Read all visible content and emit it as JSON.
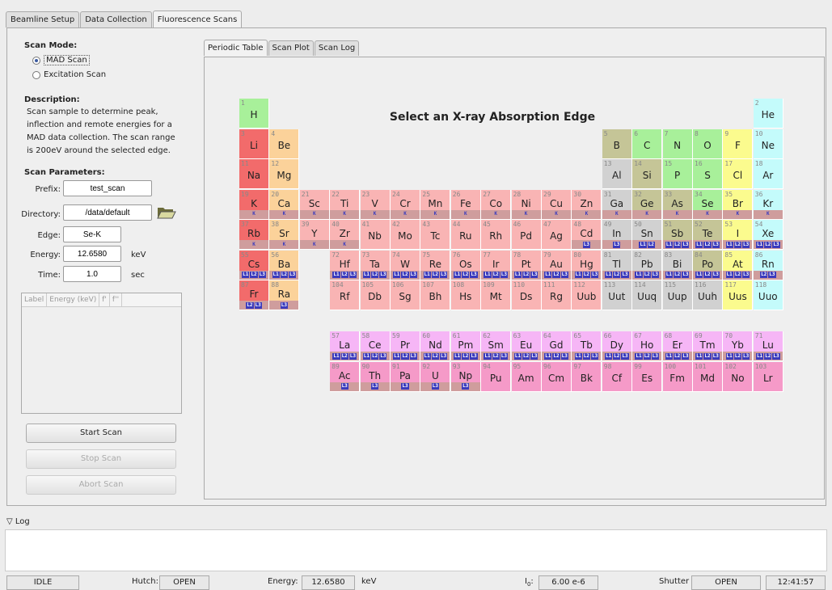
{
  "tabs": [
    "Beamline Setup",
    "Data Collection",
    "Fluorescence Scans"
  ],
  "active_tab": "Fluorescence Scans",
  "left": {
    "scan_mode_label": "Scan Mode:",
    "mode_mad": "MAD Scan",
    "mode_excitation": "Excitation Scan",
    "description_label": "Description:",
    "description": "Scan sample to determine peak, inflection and remote energies for a MAD data collection. The scan range is 200eV around the selected edge.",
    "params_label": "Scan Parameters:",
    "prefix_label": "Prefix:",
    "prefix": "test_scan",
    "directory_label": "Directory:",
    "directory": "/data/default",
    "edge_label": "Edge:",
    "edge": "Se-K",
    "energy_label": "Energy:",
    "energy": "12.6580",
    "energy_unit": "keV",
    "time_label": "Time:",
    "time": "1.0",
    "time_unit": "sec",
    "table_cols": [
      "Label",
      "Energy (keV)",
      "f'",
      "f''"
    ],
    "start_button": "Start Scan",
    "stop_button": "Stop Scan",
    "abort_button": "Abort Scan"
  },
  "subtabs": [
    "Periodic Table",
    "Scan Plot",
    "Scan Log"
  ],
  "active_subtab": "Periodic Table",
  "periodic": {
    "title": "Select an X-ray Absorption Edge",
    "colors": {
      "alkali": "#f26b6b",
      "alkaline": "#fbd29a",
      "transition": "#f9b4b4",
      "post": "#d1d1d1",
      "metalloid": "#c5c597",
      "nonmetal": "#a8f09a",
      "halogen": "#fbfb8e",
      "noble": "#c4fbfb",
      "lanthanide": "#f6b6f6",
      "actinide": "#f59ac8",
      "edge_band": "#cf9d9d"
    },
    "elements": [
      {
        "z": "1",
        "s": "H",
        "c": "nonmetal",
        "r": 1,
        "g": 1
      },
      {
        "z": "2",
        "s": "He",
        "c": "noble",
        "r": 1,
        "g": 18
      },
      {
        "z": "3",
        "s": "Li",
        "c": "alkali",
        "r": 2,
        "g": 1
      },
      {
        "z": "4",
        "s": "Be",
        "c": "alkaline",
        "r": 2,
        "g": 2
      },
      {
        "z": "5",
        "s": "B",
        "c": "metalloid",
        "r": 2,
        "g": 13
      },
      {
        "z": "6",
        "s": "C",
        "c": "nonmetal",
        "r": 2,
        "g": 14
      },
      {
        "z": "7",
        "s": "N",
        "c": "nonmetal",
        "r": 2,
        "g": 15
      },
      {
        "z": "8",
        "s": "O",
        "c": "nonmetal",
        "r": 2,
        "g": 16
      },
      {
        "z": "9",
        "s": "F",
        "c": "halogen",
        "r": 2,
        "g": 17
      },
      {
        "z": "10",
        "s": "Ne",
        "c": "noble",
        "r": 2,
        "g": 18
      },
      {
        "z": "11",
        "s": "Na",
        "c": "alkali",
        "r": 3,
        "g": 1
      },
      {
        "z": "12",
        "s": "Mg",
        "c": "alkaline",
        "r": 3,
        "g": 2
      },
      {
        "z": "13",
        "s": "Al",
        "c": "post",
        "r": 3,
        "g": 13
      },
      {
        "z": "14",
        "s": "Si",
        "c": "metalloid",
        "r": 3,
        "g": 14
      },
      {
        "z": "15",
        "s": "P",
        "c": "nonmetal",
        "r": 3,
        "g": 15
      },
      {
        "z": "16",
        "s": "S",
        "c": "nonmetal",
        "r": 3,
        "g": 16
      },
      {
        "z": "17",
        "s": "Cl",
        "c": "halogen",
        "r": 3,
        "g": 17
      },
      {
        "z": "18",
        "s": "Ar",
        "c": "noble",
        "r": 3,
        "g": 18
      },
      {
        "z": "19",
        "s": "K",
        "c": "alkali",
        "r": 4,
        "g": 1,
        "e": [
          "K"
        ]
      },
      {
        "z": "20",
        "s": "Ca",
        "c": "alkaline",
        "r": 4,
        "g": 2,
        "e": [
          "K"
        ]
      },
      {
        "z": "21",
        "s": "Sc",
        "c": "transition",
        "r": 4,
        "g": 3,
        "e": [
          "K"
        ]
      },
      {
        "z": "22",
        "s": "Ti",
        "c": "transition",
        "r": 4,
        "g": 4,
        "e": [
          "K"
        ]
      },
      {
        "z": "23",
        "s": "V",
        "c": "transition",
        "r": 4,
        "g": 5,
        "e": [
          "K"
        ]
      },
      {
        "z": "24",
        "s": "Cr",
        "c": "transition",
        "r": 4,
        "g": 6,
        "e": [
          "K"
        ]
      },
      {
        "z": "25",
        "s": "Mn",
        "c": "transition",
        "r": 4,
        "g": 7,
        "e": [
          "K"
        ]
      },
      {
        "z": "26",
        "s": "Fe",
        "c": "transition",
        "r": 4,
        "g": 8,
        "e": [
          "K"
        ]
      },
      {
        "z": "27",
        "s": "Co",
        "c": "transition",
        "r": 4,
        "g": 9,
        "e": [
          "K"
        ]
      },
      {
        "z": "28",
        "s": "Ni",
        "c": "transition",
        "r": 4,
        "g": 10,
        "e": [
          "K"
        ]
      },
      {
        "z": "29",
        "s": "Cu",
        "c": "transition",
        "r": 4,
        "g": 11,
        "e": [
          "K"
        ]
      },
      {
        "z": "30",
        "s": "Zn",
        "c": "transition",
        "r": 4,
        "g": 12,
        "e": [
          "K"
        ]
      },
      {
        "z": "31",
        "s": "Ga",
        "c": "post",
        "r": 4,
        "g": 13,
        "e": [
          "K"
        ]
      },
      {
        "z": "32",
        "s": "Ge",
        "c": "metalloid",
        "r": 4,
        "g": 14,
        "e": [
          "K"
        ]
      },
      {
        "z": "33",
        "s": "As",
        "c": "metalloid",
        "r": 4,
        "g": 15,
        "e": [
          "K"
        ]
      },
      {
        "z": "34",
        "s": "Se",
        "c": "nonmetal",
        "r": 4,
        "g": 16,
        "e": [
          "K"
        ]
      },
      {
        "z": "35",
        "s": "Br",
        "c": "halogen",
        "r": 4,
        "g": 17,
        "e": [
          "K"
        ]
      },
      {
        "z": "36",
        "s": "Kr",
        "c": "noble",
        "r": 4,
        "g": 18,
        "e": [
          "K"
        ]
      },
      {
        "z": "37",
        "s": "Rb",
        "c": "alkali",
        "r": 5,
        "g": 1,
        "e": [
          "K"
        ]
      },
      {
        "z": "38",
        "s": "Sr",
        "c": "alkaline",
        "r": 5,
        "g": 2,
        "e": [
          "K"
        ]
      },
      {
        "z": "39",
        "s": "Y",
        "c": "transition",
        "r": 5,
        "g": 3,
        "e": [
          "K"
        ]
      },
      {
        "z": "40",
        "s": "Zr",
        "c": "transition",
        "r": 5,
        "g": 4,
        "e": [
          "K"
        ]
      },
      {
        "z": "41",
        "s": "Nb",
        "c": "transition",
        "r": 5,
        "g": 5
      },
      {
        "z": "42",
        "s": "Mo",
        "c": "transition",
        "r": 5,
        "g": 6
      },
      {
        "z": "43",
        "s": "Tc",
        "c": "transition",
        "r": 5,
        "g": 7
      },
      {
        "z": "44",
        "s": "Ru",
        "c": "transition",
        "r": 5,
        "g": 8
      },
      {
        "z": "45",
        "s": "Rh",
        "c": "transition",
        "r": 5,
        "g": 9
      },
      {
        "z": "46",
        "s": "Pd",
        "c": "transition",
        "r": 5,
        "g": 10
      },
      {
        "z": "47",
        "s": "Ag",
        "c": "transition",
        "r": 5,
        "g": 11
      },
      {
        "z": "48",
        "s": "Cd",
        "c": "transition",
        "r": 5,
        "g": 12,
        "e": [
          "L3"
        ]
      },
      {
        "z": "49",
        "s": "In",
        "c": "post",
        "r": 5,
        "g": 13,
        "e": [
          "L3"
        ]
      },
      {
        "z": "50",
        "s": "Sn",
        "c": "post",
        "r": 5,
        "g": 14,
        "e": [
          "L1",
          "L2"
        ]
      },
      {
        "z": "51",
        "s": "Sb",
        "c": "metalloid",
        "r": 5,
        "g": 15,
        "e": [
          "L1",
          "L2",
          "L3"
        ]
      },
      {
        "z": "52",
        "s": "Te",
        "c": "metalloid",
        "r": 5,
        "g": 16,
        "e": [
          "L1",
          "L2",
          "L3"
        ]
      },
      {
        "z": "53",
        "s": "I",
        "c": "halogen",
        "r": 5,
        "g": 17,
        "e": [
          "L1",
          "L2",
          "L3"
        ]
      },
      {
        "z": "54",
        "s": "Xe",
        "c": "noble",
        "r": 5,
        "g": 18,
        "e": [
          "L1",
          "L2",
          "L3"
        ]
      },
      {
        "z": "55",
        "s": "Cs",
        "c": "alkali",
        "r": 6,
        "g": 1,
        "e": [
          "L1",
          "L2",
          "L3"
        ]
      },
      {
        "z": "56",
        "s": "Ba",
        "c": "alkaline",
        "r": 6,
        "g": 2,
        "e": [
          "L1",
          "L2",
          "L3"
        ]
      },
      {
        "z": "72",
        "s": "Hf",
        "c": "transition",
        "r": 6,
        "g": 4,
        "e": [
          "L1",
          "L2",
          "L3"
        ]
      },
      {
        "z": "73",
        "s": "Ta",
        "c": "transition",
        "r": 6,
        "g": 5,
        "e": [
          "L1",
          "L2",
          "L3"
        ]
      },
      {
        "z": "74",
        "s": "W",
        "c": "transition",
        "r": 6,
        "g": 6,
        "e": [
          "L1",
          "L2",
          "L3"
        ]
      },
      {
        "z": "75",
        "s": "Re",
        "c": "transition",
        "r": 6,
        "g": 7,
        "e": [
          "L1",
          "L2",
          "L3"
        ]
      },
      {
        "z": "76",
        "s": "Os",
        "c": "transition",
        "r": 6,
        "g": 8,
        "e": [
          "L1",
          "L2",
          "L3"
        ]
      },
      {
        "z": "77",
        "s": "Ir",
        "c": "transition",
        "r": 6,
        "g": 9,
        "e": [
          "L1",
          "L2",
          "L3"
        ]
      },
      {
        "z": "78",
        "s": "Pt",
        "c": "transition",
        "r": 6,
        "g": 10,
        "e": [
          "L1",
          "L2",
          "L3"
        ]
      },
      {
        "z": "79",
        "s": "Au",
        "c": "transition",
        "r": 6,
        "g": 11,
        "e": [
          "L1",
          "L2",
          "L3"
        ]
      },
      {
        "z": "80",
        "s": "Hg",
        "c": "transition",
        "r": 6,
        "g": 12,
        "e": [
          "L1",
          "L2",
          "L3"
        ]
      },
      {
        "z": "81",
        "s": "Tl",
        "c": "post",
        "r": 6,
        "g": 13,
        "e": [
          "L1",
          "L2",
          "L3"
        ]
      },
      {
        "z": "82",
        "s": "Pb",
        "c": "post",
        "r": 6,
        "g": 14,
        "e": [
          "L1",
          "L2",
          "L3"
        ]
      },
      {
        "z": "83",
        "s": "Bi",
        "c": "post",
        "r": 6,
        "g": 15,
        "e": [
          "L1",
          "L2",
          "L3"
        ]
      },
      {
        "z": "84",
        "s": "Po",
        "c": "metalloid",
        "r": 6,
        "g": 16,
        "e": [
          "L1",
          "L2",
          "L3"
        ]
      },
      {
        "z": "85",
        "s": "At",
        "c": "halogen",
        "r": 6,
        "g": 17,
        "e": [
          "L1",
          "L2",
          "L3"
        ]
      },
      {
        "z": "86",
        "s": "Rn",
        "c": "noble",
        "r": 6,
        "g": 18,
        "e": [
          "L2",
          "L3"
        ]
      },
      {
        "z": "87",
        "s": "Fr",
        "c": "alkali",
        "r": 7,
        "g": 1,
        "e": [
          "L2",
          "L3"
        ]
      },
      {
        "z": "88",
        "s": "Ra",
        "c": "alkaline",
        "r": 7,
        "g": 2,
        "e": [
          "L3"
        ]
      },
      {
        "z": "104",
        "s": "Rf",
        "c": "transition",
        "r": 7,
        "g": 4
      },
      {
        "z": "105",
        "s": "Db",
        "c": "transition",
        "r": 7,
        "g": 5
      },
      {
        "z": "106",
        "s": "Sg",
        "c": "transition",
        "r": 7,
        "g": 6
      },
      {
        "z": "107",
        "s": "Bh",
        "c": "transition",
        "r": 7,
        "g": 7
      },
      {
        "z": "108",
        "s": "Hs",
        "c": "transition",
        "r": 7,
        "g": 8
      },
      {
        "z": "109",
        "s": "Mt",
        "c": "transition",
        "r": 7,
        "g": 9
      },
      {
        "z": "110",
        "s": "Ds",
        "c": "transition",
        "r": 7,
        "g": 10
      },
      {
        "z": "111",
        "s": "Rg",
        "c": "transition",
        "r": 7,
        "g": 11
      },
      {
        "z": "112",
        "s": "Uub",
        "c": "transition",
        "r": 7,
        "g": 12
      },
      {
        "z": "113",
        "s": "Uut",
        "c": "post",
        "r": 7,
        "g": 13
      },
      {
        "z": "114",
        "s": "Uuq",
        "c": "post",
        "r": 7,
        "g": 14
      },
      {
        "z": "115",
        "s": "Uup",
        "c": "post",
        "r": 7,
        "g": 15
      },
      {
        "z": "116",
        "s": "Uuh",
        "c": "post",
        "r": 7,
        "g": 16
      },
      {
        "z": "117",
        "s": "Uus",
        "c": "halogen",
        "r": 7,
        "g": 17
      },
      {
        "z": "118",
        "s": "Uuo",
        "c": "noble",
        "r": 7,
        "g": 18
      },
      {
        "z": "57",
        "s": "La",
        "c": "lanthanide",
        "r": 9,
        "g": 4,
        "e": [
          "L1",
          "L2",
          "L3"
        ]
      },
      {
        "z": "58",
        "s": "Ce",
        "c": "lanthanide",
        "r": 9,
        "g": 5,
        "e": [
          "L1",
          "L2",
          "L3"
        ]
      },
      {
        "z": "59",
        "s": "Pr",
        "c": "lanthanide",
        "r": 9,
        "g": 6,
        "e": [
          "L1",
          "L2",
          "L3"
        ]
      },
      {
        "z": "60",
        "s": "Nd",
        "c": "lanthanide",
        "r": 9,
        "g": 7,
        "e": [
          "L1",
          "L2",
          "L3"
        ]
      },
      {
        "z": "61",
        "s": "Pm",
        "c": "lanthanide",
        "r": 9,
        "g": 8,
        "e": [
          "L1",
          "L2",
          "L3"
        ]
      },
      {
        "z": "62",
        "s": "Sm",
        "c": "lanthanide",
        "r": 9,
        "g": 9,
        "e": [
          "L1",
          "L2",
          "L3"
        ]
      },
      {
        "z": "63",
        "s": "Eu",
        "c": "lanthanide",
        "r": 9,
        "g": 10,
        "e": [
          "L1",
          "L2",
          "L3"
        ]
      },
      {
        "z": "64",
        "s": "Gd",
        "c": "lanthanide",
        "r": 9,
        "g": 11,
        "e": [
          "L1",
          "L2",
          "L3"
        ]
      },
      {
        "z": "65",
        "s": "Tb",
        "c": "lanthanide",
        "r": 9,
        "g": 12,
        "e": [
          "L1",
          "L2",
          "L3"
        ]
      },
      {
        "z": "66",
        "s": "Dy",
        "c": "lanthanide",
        "r": 9,
        "g": 13,
        "e": [
          "L1",
          "L2",
          "L3"
        ]
      },
      {
        "z": "67",
        "s": "Ho",
        "c": "lanthanide",
        "r": 9,
        "g": 14,
        "e": [
          "L1",
          "L2",
          "L3"
        ]
      },
      {
        "z": "68",
        "s": "Er",
        "c": "lanthanide",
        "r": 9,
        "g": 15,
        "e": [
          "L1",
          "L2",
          "L3"
        ]
      },
      {
        "z": "69",
        "s": "Tm",
        "c": "lanthanide",
        "r": 9,
        "g": 16,
        "e": [
          "L1",
          "L2",
          "L3"
        ]
      },
      {
        "z": "70",
        "s": "Yb",
        "c": "lanthanide",
        "r": 9,
        "g": 17,
        "e": [
          "L1",
          "L2",
          "L3"
        ]
      },
      {
        "z": "71",
        "s": "Lu",
        "c": "lanthanide",
        "r": 9,
        "g": 18,
        "e": [
          "L1",
          "L2",
          "L3"
        ]
      },
      {
        "z": "89",
        "s": "Ac",
        "c": "actinide",
        "r": 10,
        "g": 4,
        "e": [
          "L3"
        ]
      },
      {
        "z": "90",
        "s": "Th",
        "c": "actinide",
        "r": 10,
        "g": 5,
        "e": [
          "L3"
        ]
      },
      {
        "z": "91",
        "s": "Pa",
        "c": "actinide",
        "r": 10,
        "g": 6,
        "e": [
          "L3"
        ]
      },
      {
        "z": "92",
        "s": "U",
        "c": "actinide",
        "r": 10,
        "g": 7,
        "e": [
          "L3"
        ]
      },
      {
        "z": "93",
        "s": "Np",
        "c": "actinide",
        "r": 10,
        "g": 8,
        "e": [
          "L3"
        ]
      },
      {
        "z": "94",
        "s": "Pu",
        "c": "actinide",
        "r": 10,
        "g": 9
      },
      {
        "z": "95",
        "s": "Am",
        "c": "actinide",
        "r": 10,
        "g": 10
      },
      {
        "z": "96",
        "s": "Cm",
        "c": "actinide",
        "r": 10,
        "g": 11
      },
      {
        "z": "97",
        "s": "Bk",
        "c": "actinide",
        "r": 10,
        "g": 12
      },
      {
        "z": "98",
        "s": "Cf",
        "c": "actinide",
        "r": 10,
        "g": 13
      },
      {
        "z": "99",
        "s": "Es",
        "c": "actinide",
        "r": 10,
        "g": 14
      },
      {
        "z": "100",
        "s": "Fm",
        "c": "actinide",
        "r": 10,
        "g": 15
      },
      {
        "z": "101",
        "s": "Md",
        "c": "actinide",
        "r": 10,
        "g": 16
      },
      {
        "z": "102",
        "s": "No",
        "c": "actinide",
        "r": 10,
        "g": 17
      },
      {
        "z": "103",
        "s": "Lr",
        "c": "actinide",
        "r": 10,
        "g": 18
      }
    ]
  },
  "log": {
    "label": "Log"
  },
  "status": {
    "state": "IDLE",
    "hutch_label": "Hutch:",
    "hutch": "OPEN",
    "energy_label": "Energy:",
    "energy": "12.6580",
    "energy_unit": "keV",
    "i0_label": "I",
    "i0_sub": "0",
    "i0_value": "6.00 e-6",
    "shutter_label": "Shutter",
    "shutter": "OPEN",
    "time": "12:41:57"
  }
}
